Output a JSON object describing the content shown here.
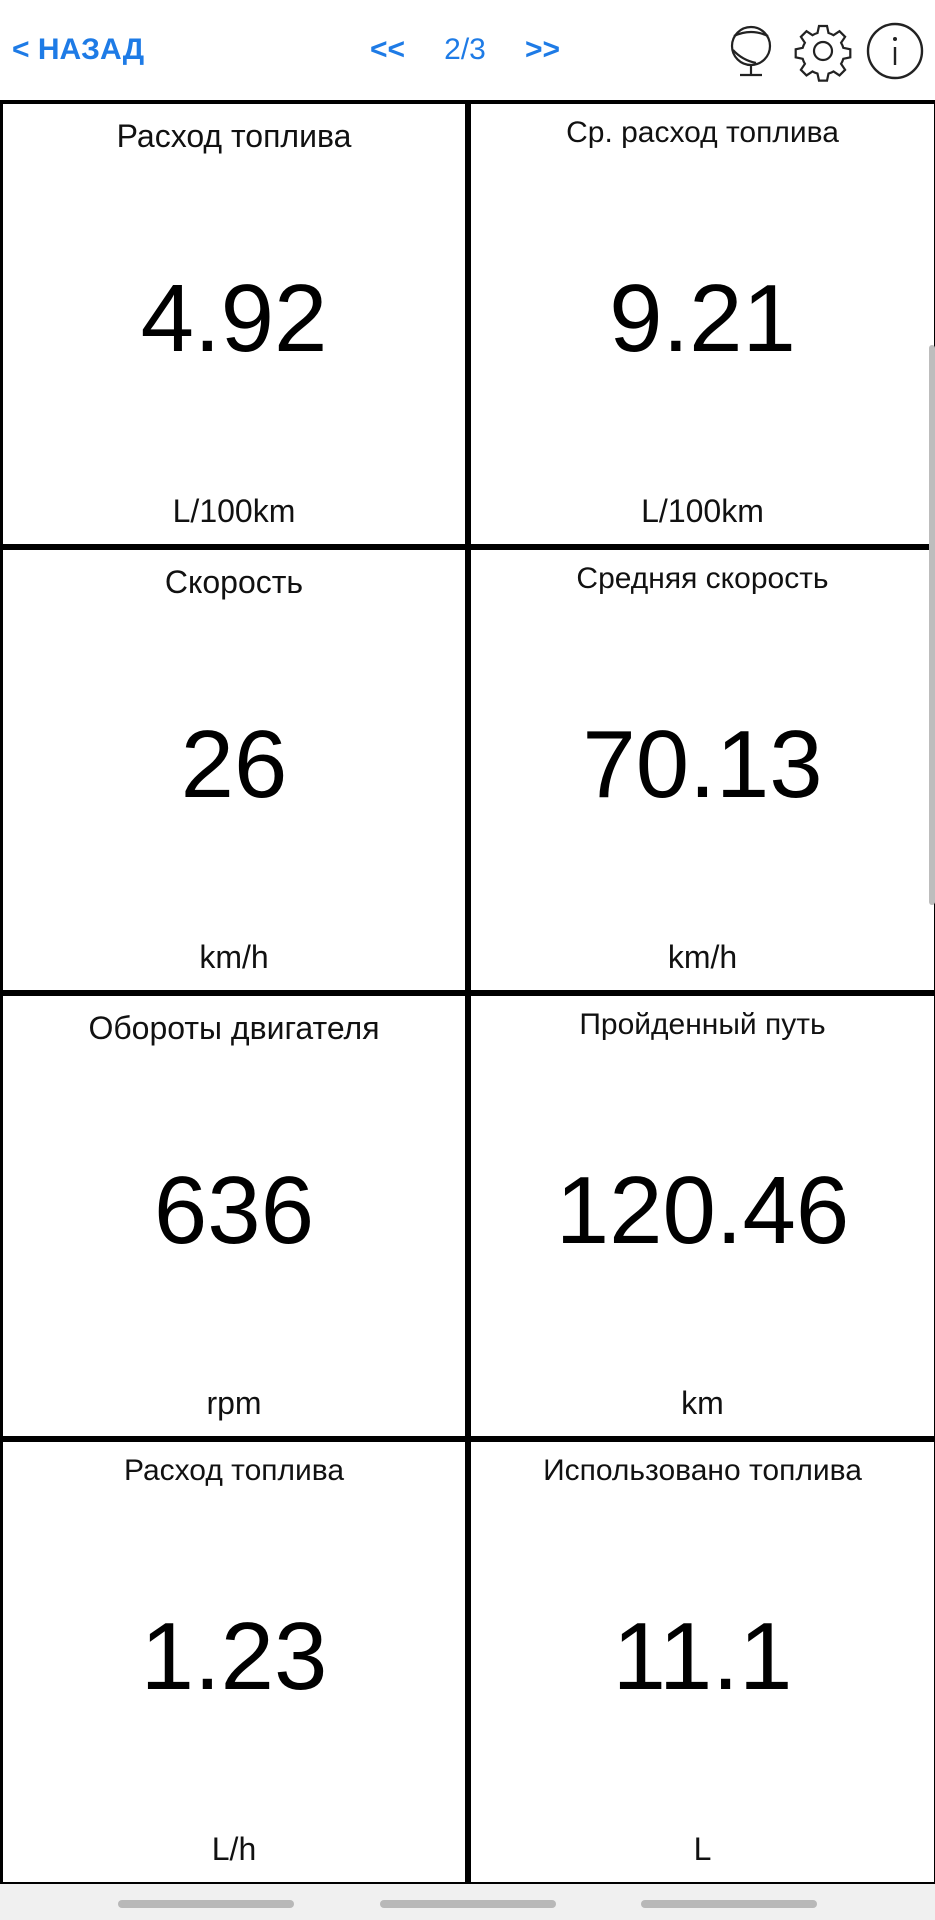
{
  "header": {
    "back_label": "< НАЗАД",
    "prev_label": "<<",
    "page_indicator": "2/3",
    "next_label": ">>",
    "icons": [
      "globe-icon",
      "gear-icon",
      "info-icon"
    ],
    "accent_color": "#1e7be6"
  },
  "tiles": [
    {
      "title": "Расход топлива",
      "value": "4.92",
      "unit": "L/100km"
    },
    {
      "title": "Ср. расход топлива",
      "value": "9.21",
      "unit": "L/100km"
    },
    {
      "title": "Скорость",
      "value": "26",
      "unit": "km/h"
    },
    {
      "title": "Средняя скорость",
      "value": "70.13",
      "unit": "km/h"
    },
    {
      "title": "Обороты двигателя",
      "value": "636",
      "unit": "rpm"
    },
    {
      "title": "Пройденный путь",
      "value": "120.46",
      "unit": "km"
    },
    {
      "title": "Расход топлива",
      "value": "1.23",
      "unit": "L/h"
    },
    {
      "title": "Использовано топлива",
      "value": "11.1",
      "unit": "L"
    }
  ]
}
